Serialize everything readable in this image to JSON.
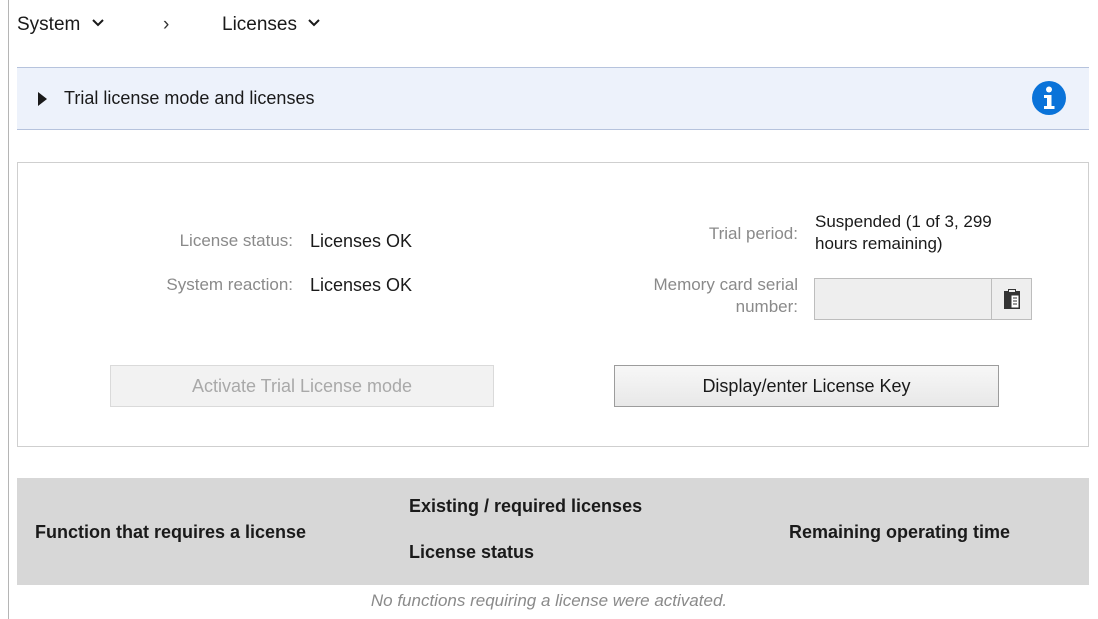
{
  "breadcrumb": {
    "items": [
      "System",
      "Licenses"
    ],
    "separator": "›"
  },
  "trial_section": {
    "title": "Trial license mode and licenses",
    "info_icon": "info-icon",
    "info_color": "#0a73d9"
  },
  "license_panel": {
    "license_status_label": "License status:",
    "license_status_value": "Licenses OK",
    "system_reaction_label": "System reaction:",
    "system_reaction_value": "Licenses OK",
    "trial_period_label": "Trial period:",
    "trial_period_value_line1": "Suspended (1 of 3, 299",
    "trial_period_value_line2": "hours remaining)",
    "memory_card_label_line1": "Memory card serial",
    "memory_card_label_line2": "number:",
    "memory_card_value": "",
    "clipboard_icon": "clipboard-icon",
    "activate_trial_button": "Activate Trial License mode",
    "display_license_key_button": "Display/enter License Key"
  },
  "license_table": {
    "columns": {
      "function": "Function that requires a license",
      "existing_required": "Existing / required licenses",
      "license_status": "License status",
      "remaining_time": "Remaining operating time"
    },
    "rows": [],
    "empty_message": "No functions requiring a license were activated."
  }
}
